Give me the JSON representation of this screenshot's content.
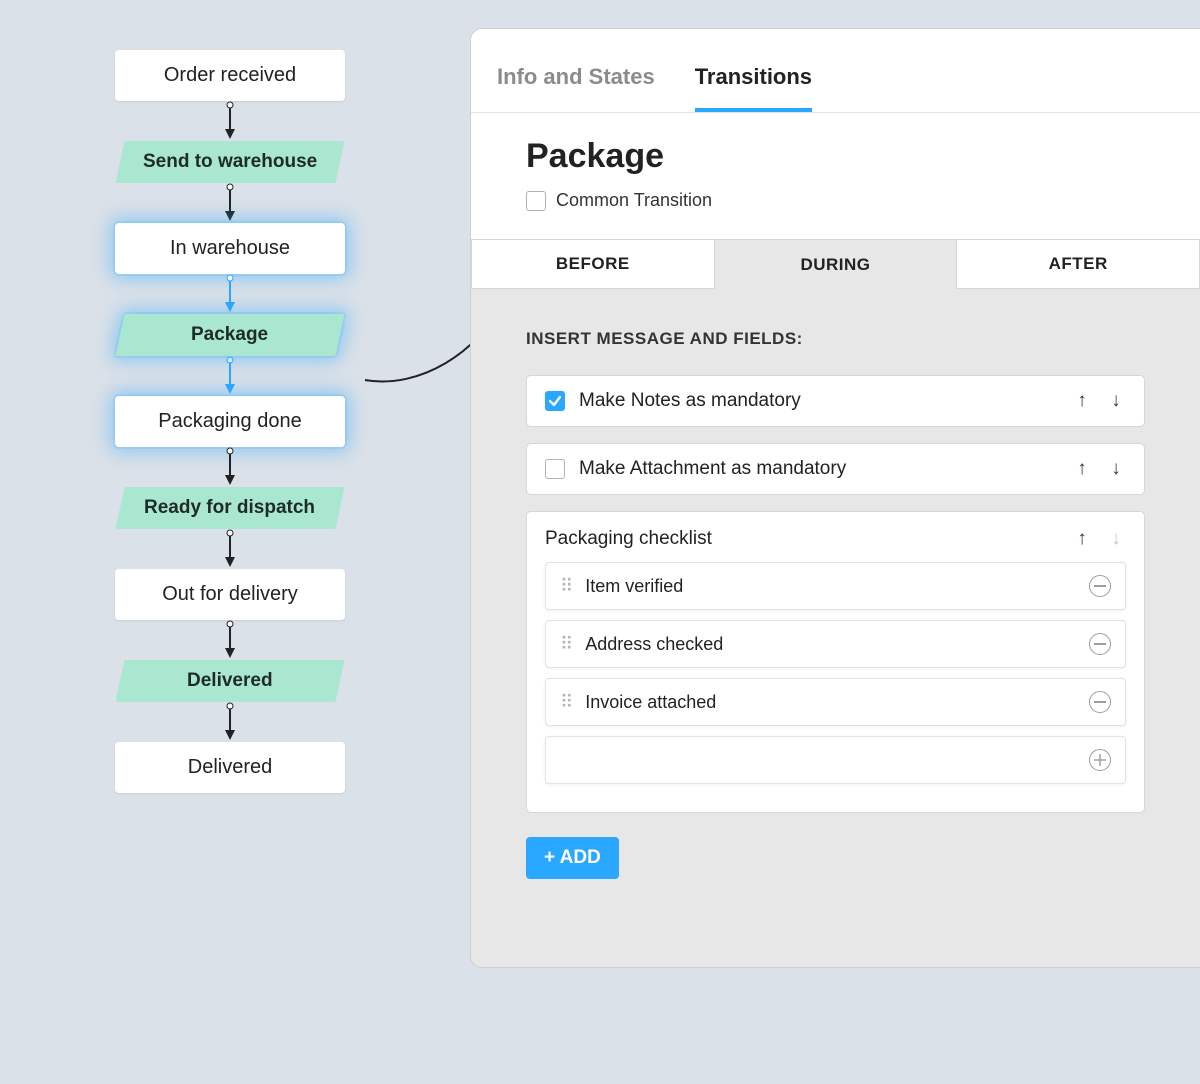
{
  "flow": {
    "nodes": [
      {
        "kind": "state",
        "label": "Order received",
        "glow": false
      },
      {
        "kind": "arrow",
        "color": "#222"
      },
      {
        "kind": "transition",
        "label": "Send to warehouse",
        "selected": false
      },
      {
        "kind": "arrow",
        "color": "#222"
      },
      {
        "kind": "state",
        "label": "In warehouse",
        "glow": true
      },
      {
        "kind": "arrow",
        "color": "#2aa7ff"
      },
      {
        "kind": "transition",
        "label": "Package",
        "selected": true
      },
      {
        "kind": "arrow",
        "color": "#2aa7ff"
      },
      {
        "kind": "state",
        "label": "Packaging done",
        "glow": true
      },
      {
        "kind": "arrow",
        "color": "#222"
      },
      {
        "kind": "transition",
        "label": "Ready for dispatch",
        "selected": false
      },
      {
        "kind": "arrow",
        "color": "#222"
      },
      {
        "kind": "state",
        "label": "Out for delivery",
        "glow": false
      },
      {
        "kind": "arrow",
        "color": "#222"
      },
      {
        "kind": "transition",
        "label": "Delivered",
        "selected": false
      },
      {
        "kind": "arrow",
        "color": "#222"
      },
      {
        "kind": "state",
        "label": "Delivered",
        "glow": false
      }
    ]
  },
  "panel": {
    "topTabs": {
      "info": "Info and States",
      "transitions": "Transitions",
      "active": "transitions"
    },
    "title": "Package",
    "common": {
      "label": "Common Transition",
      "checked": false
    },
    "phases": {
      "before": "BEFORE",
      "during": "DURING",
      "after": "AFTER",
      "active": "during"
    },
    "section": "INSERT MESSAGE AND FIELDS:",
    "fields": [
      {
        "label": "Make Notes as mandatory",
        "checked": true
      },
      {
        "label": "Make Attachment as mandatory",
        "checked": false
      }
    ],
    "group": {
      "title": "Packaging checklist",
      "items": [
        {
          "label": "Item verified"
        },
        {
          "label": "Address checked"
        },
        {
          "label": "Invoice attached"
        }
      ]
    },
    "add": "+ ADD"
  }
}
